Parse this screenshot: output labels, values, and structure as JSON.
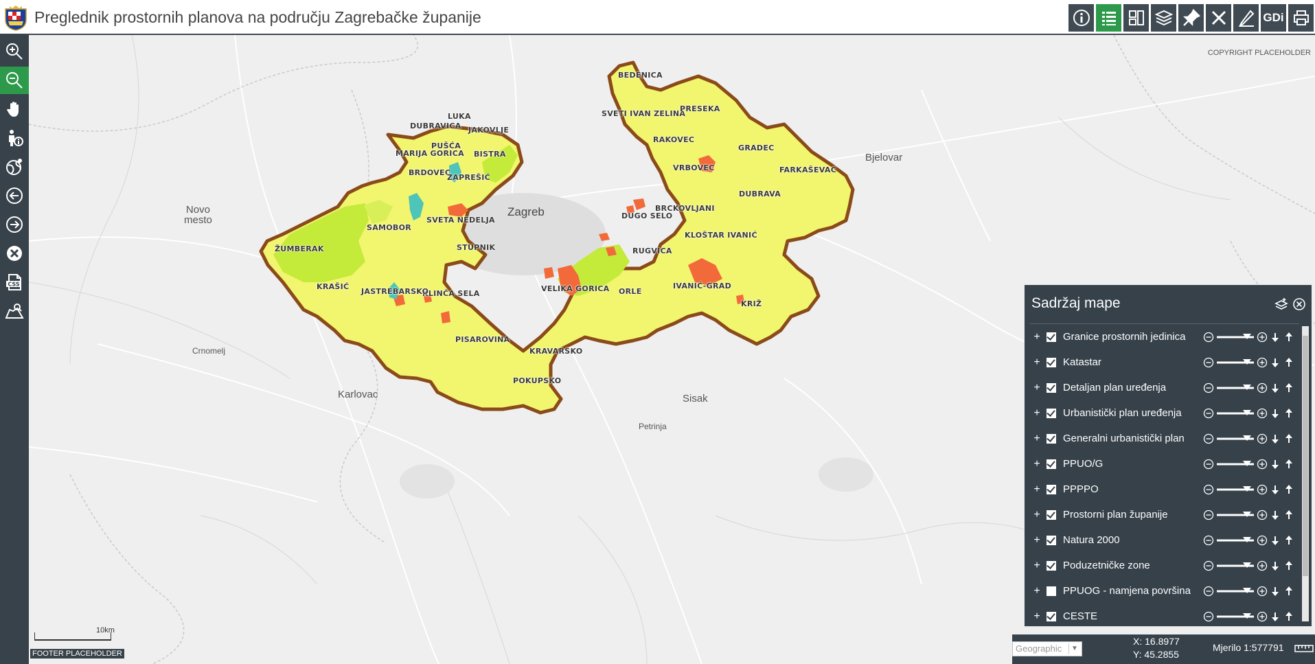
{
  "header": {
    "title": "Preglednik prostornih planova na području Zagrebačke županije",
    "tools": [
      {
        "name": "info-icon"
      },
      {
        "name": "legend-list-icon",
        "active": true
      },
      {
        "name": "layout-grid-icon"
      },
      {
        "name": "layers-icon"
      },
      {
        "name": "pin-icon"
      },
      {
        "name": "measure-tools-icon"
      },
      {
        "name": "edit-icon"
      },
      {
        "name": "gdi-text",
        "label": "GDi"
      },
      {
        "name": "print-icon"
      }
    ]
  },
  "left_tools": [
    "zoom-in-icon",
    "zoom-out-icon",
    "pan-hand-icon",
    "identify-icon",
    "globe-icon",
    "back-arrow-icon",
    "forward-arrow-icon",
    "clear-icon",
    "css-icon",
    "map-search-icon"
  ],
  "map": {
    "copyright": "COPYRIGHT PLACEHOLDER",
    "cities": [
      {
        "name": "Zagreb"
      },
      {
        "name": "Novo\nmesto"
      },
      {
        "name": "Karlovac"
      },
      {
        "name": "Sisak"
      },
      {
        "name": "Bjelovar"
      },
      {
        "name": "Crnomelj"
      },
      {
        "name": "Petrinja"
      }
    ],
    "municipalities": [
      "BEDENICA",
      "SVETI IVAN ZELINA",
      "PRESEKA",
      "RAKOVEC",
      "GRADEC",
      "VRBOVEC",
      "FARKAŠEVAC",
      "DUBRAVA",
      "BRCKOVLJANI",
      "DUGO SELO",
      "KLOŠTAR IVANIĆ",
      "RUGVICA",
      "IVANIĆ-GRAD",
      "KRIŽ",
      "ORLE",
      "VELIKA GORICA",
      "KRAVARSKO",
      "POKUPSKO",
      "PISAROVINA",
      "KLINČA SELA",
      "JASTREBARSKO",
      "KRAŠIĆ",
      "ŽUMBERAK",
      "SAMOBOR",
      "SVETA NEDELJA",
      "STUPNIK",
      "BRDOVEC",
      "ZAPREŠIĆ",
      "MARIJA GORICA",
      "PUŠĆA",
      "BISTRA",
      "DUBRAVICA",
      "LUKA",
      "JAKOVLJE"
    ],
    "scale_label": "10km",
    "footer": "FOOTER PLACEHOLDER"
  },
  "panel": {
    "title": "Sadržaj mape",
    "layers": [
      {
        "name": "Granice prostornih jedinica",
        "checked": true
      },
      {
        "name": "Katastar",
        "checked": true
      },
      {
        "name": "Detaljan plan uređenja",
        "checked": true
      },
      {
        "name": "Urbanistički plan uređenja",
        "checked": true
      },
      {
        "name": "Generalni urbanistički plan",
        "checked": true
      },
      {
        "name": "PPUO/G",
        "checked": true
      },
      {
        "name": "PPPPO",
        "checked": true
      },
      {
        "name": "Prostorni plan županije",
        "checked": true
      },
      {
        "name": "Natura 2000",
        "checked": true
      },
      {
        "name": "Poduzetničke zone",
        "checked": true
      },
      {
        "name": "PPUOG - namjena površina",
        "checked": false
      },
      {
        "name": "CESTE",
        "checked": true
      }
    ]
  },
  "status": {
    "projection": "Geographic",
    "x": "X: 16.8977",
    "y": "Y: 45.2855",
    "scale": "Mjerilo 1:577791"
  },
  "colors": {
    "toolbar": "#37424a",
    "active": "#2d9a4b",
    "county_fill": "#f2f56e",
    "county_border": "#8a4a1a",
    "forest": "#c4ea3a",
    "urban": "#f26a3a",
    "teal": "#4fc4b8"
  }
}
